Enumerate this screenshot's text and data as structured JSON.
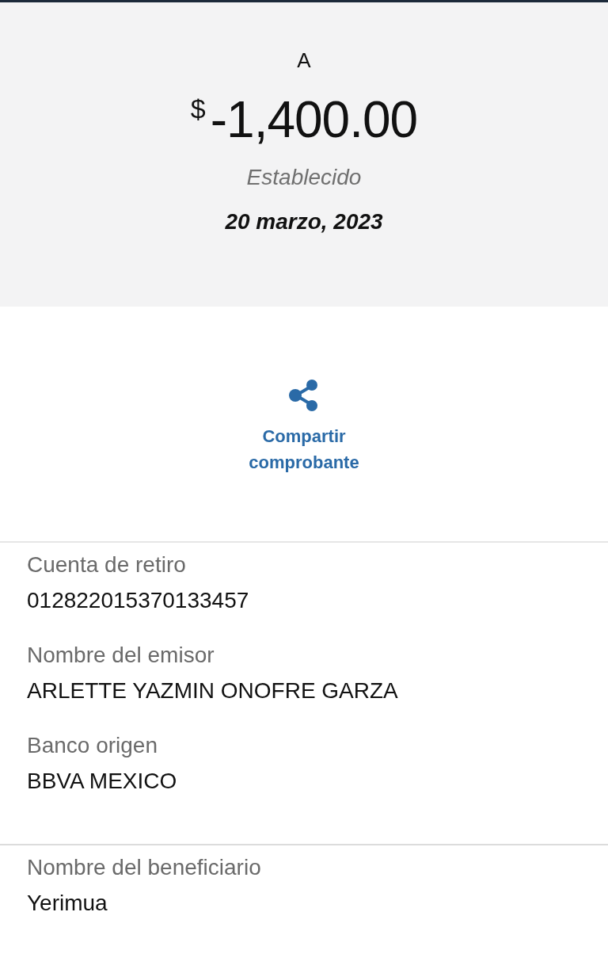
{
  "header": {
    "title": "A",
    "currency": "$",
    "amount": "-1,400.00",
    "status": "Establecido",
    "date": "20 marzo, 2023"
  },
  "share_button": {
    "label": "Compartir comprobante"
  },
  "sections": [
    {
      "fields": [
        {
          "label": "Cuenta de retiro",
          "value": "012822015370133457"
        },
        {
          "label": "Nombre del emisor",
          "value": "ARLETTE YAZMIN ONOFRE GARZA"
        },
        {
          "label": "Banco origen",
          "value": "BBVA MEXICO"
        }
      ]
    },
    {
      "fields": [
        {
          "label": "Nombre del beneficiario",
          "value": "Yerimua"
        }
      ]
    }
  ]
}
